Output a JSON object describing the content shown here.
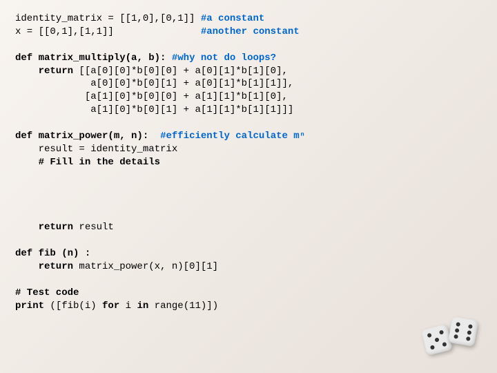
{
  "code": {
    "l01a": "identity_matrix = [[1,0],[0,1]] ",
    "l01b": "#a constant",
    "l02a": "x = [[0,1],[1,1]]               ",
    "l02b": "#another constant",
    "l03": "",
    "l04a": "def",
    "l04b": " matrix_multiply(a, b): ",
    "l04c": "#why not do loops?",
    "l05a": "    return",
    "l05b": " [[a[0][0]*b[0][0] + a[0][1]*b[1][0],",
    "l06": "             a[0][0]*b[0][1] + a[0][1]*b[1][1]],",
    "l07": "            [a[1][0]*b[0][0] + a[1][1]*b[1][0],",
    "l08": "             a[1][0]*b[0][1] + a[1][1]*b[1][1]]]",
    "l09": "",
    "l10a": "def",
    "l10b": " matrix_power(m, n):  ",
    "l10c": "#efficiently calculate mⁿ",
    "l11": "    result = identity_matrix",
    "l12": "    # Fill in the details",
    "l13": "",
    "l14": "",
    "l15": "",
    "l16": "",
    "l17a": "    return",
    "l17b": " result",
    "l18": "",
    "l19a": "def",
    "l19b": " fib (n) :",
    "l20a": "    return",
    "l20b": " matrix_power(x, n)[0][1]",
    "l21": "",
    "l22": "# Test code",
    "l23a": "print",
    "l23b": " ([fib(i) ",
    "l23c": "for",
    "l23d": " i ",
    "l23e": "in",
    "l23f": " range(11)])"
  }
}
